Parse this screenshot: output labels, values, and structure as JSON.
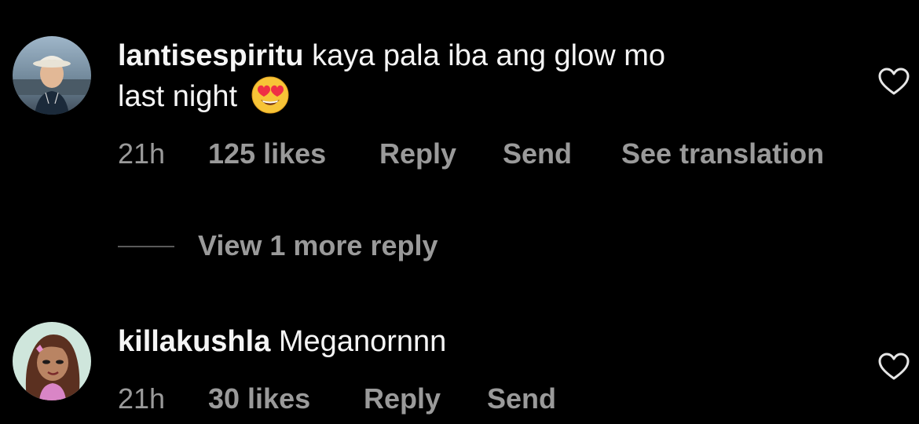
{
  "comments": [
    {
      "username": "lantisespiritu",
      "text_line1": "kaya pala iba ang glow mo",
      "text_line2": "last night",
      "emoji": "heart-eyes-emoji",
      "time": "21h",
      "likes": "125 likes",
      "reply": "Reply",
      "send": "Send",
      "translation": "See translation",
      "liked": false
    },
    {
      "username": "killakushla",
      "text": "Meganornnn",
      "time": "21h",
      "likes": "30 likes",
      "reply": "Reply",
      "send": "Send",
      "liked": false
    }
  ],
  "view_replies": {
    "label": "View 1 more reply"
  },
  "colors": {
    "background": "#000000",
    "primary_text": "#f5f5f5",
    "secondary_text": "#9a9a9a",
    "divider": "#5a5a5a"
  }
}
